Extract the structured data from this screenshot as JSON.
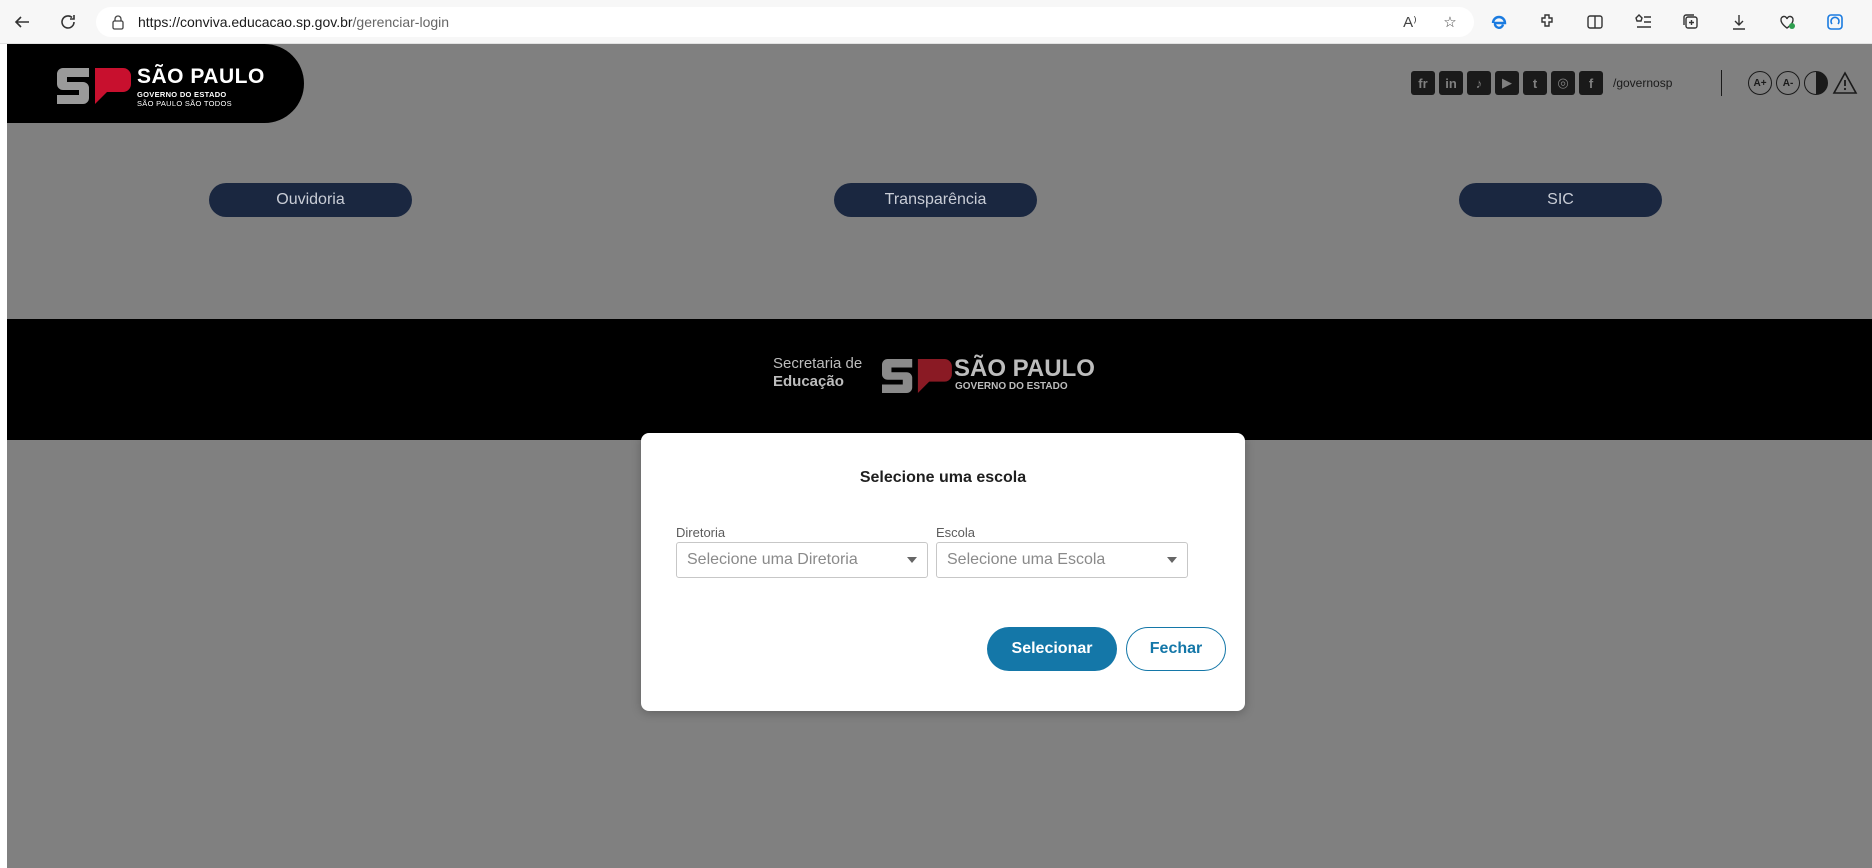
{
  "browser": {
    "url_host": "https://conviva.educacao.sp.gov.br",
    "url_path": "/gerenciar-login",
    "read_aloud_label": "A⁾"
  },
  "header": {
    "logo_title": "SÃO PAULO",
    "logo_subtitle": "GOVERNO DO ESTADO",
    "logo_tagline": "SÃO PAULO SÃO TODOS",
    "social_handle": "/governosp",
    "social_icons": [
      "flickr-icon",
      "linkedin-icon",
      "tiktok-icon",
      "youtube-icon",
      "twitter-icon",
      "instagram-icon",
      "facebook-icon"
    ],
    "social_labels": [
      "fr",
      "in",
      "♪",
      "▶",
      "t",
      "◎",
      "f"
    ],
    "a11y": {
      "increase_font": "A+",
      "decrease_font": "A-"
    }
  },
  "nav": {
    "ouvidoria": "Ouvidoria",
    "transparencia": "Transparência",
    "sic": "SIC"
  },
  "band": {
    "secretaria_line1": "Secretaria de",
    "secretaria_line2": "Educação",
    "title": "SÃO PAULO",
    "subtitle": "GOVERNO DO ESTADO"
  },
  "modal": {
    "title": "Selecione uma escola",
    "diretoria_label": "Diretoria",
    "diretoria_placeholder": "Selecione uma Diretoria",
    "escola_label": "Escola",
    "escola_placeholder": "Selecione uma Escola",
    "select_button": "Selecionar",
    "close_button": "Fechar"
  },
  "colors": {
    "overlay_gray": "#808080",
    "pill_navy": "#1a2740",
    "primary_blue": "#1477a8",
    "logo_red": "#c8102e"
  }
}
